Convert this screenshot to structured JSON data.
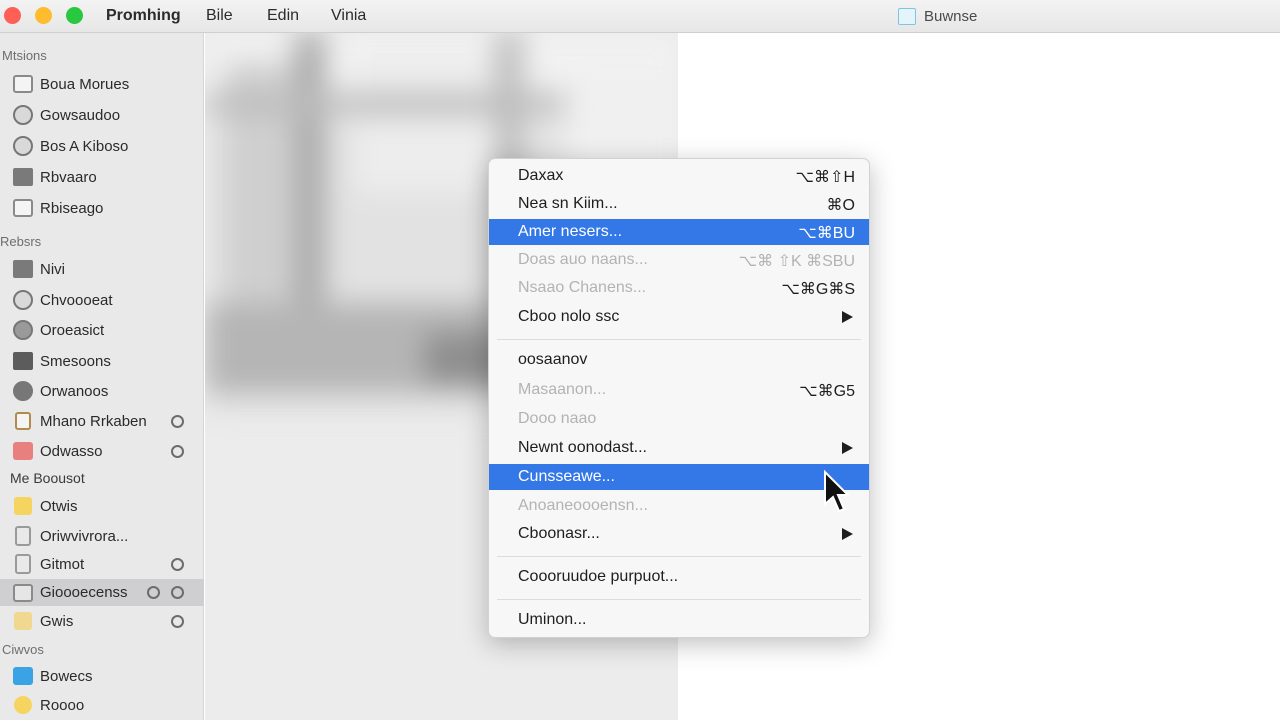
{
  "titlebar": {
    "menus": [
      "Promhing",
      "Bile",
      "Edin",
      "Vinia"
    ],
    "document_title": "Buwnse"
  },
  "sidebar": {
    "sections": [
      {
        "header": "Mtsions",
        "items": [
          {
            "label": "Boua Morues",
            "icon": "photo-icon"
          },
          {
            "label": "Gowsaudoo",
            "icon": "clock-icon"
          },
          {
            "label": "Bos A Kiboso",
            "icon": "globe-icon"
          },
          {
            "label": "Rbvaaro",
            "icon": "monitor-icon"
          },
          {
            "label": "Rbiseago",
            "icon": "image-icon"
          }
        ]
      },
      {
        "header": "Rebsrs",
        "items": [
          {
            "label": "Nivi",
            "icon": "monitor-icon"
          },
          {
            "label": "Chvoooeat",
            "icon": "gear-icon"
          },
          {
            "label": "Oroeasict",
            "icon": "gear-icon"
          },
          {
            "label": "Smesoons",
            "icon": "folder-icon"
          },
          {
            "label": "Orwanoos",
            "icon": "disc-icon"
          },
          {
            "label": "Mhano Rrkaben",
            "icon": "badge-icon",
            "badge": true
          },
          {
            "label": "Odwasso",
            "icon": "red-folder-icon",
            "badge": true
          }
        ]
      },
      {
        "header": "Me Boousot",
        "items": [
          {
            "label": "Otwis",
            "icon": "note-icon"
          },
          {
            "label": "Oriwvivrora...",
            "icon": "note-outline-icon"
          },
          {
            "label": "Gitmot",
            "icon": "note-outline-icon",
            "badge": true
          },
          {
            "label": "Gioooecenss",
            "icon": "archive-icon",
            "badge": true,
            "second_badge": true,
            "selected": true
          },
          {
            "label": "Gwis",
            "icon": "note-icon",
            "badge": true
          }
        ]
      },
      {
        "header": "Ciwvos",
        "items": [
          {
            "label": "Bowecs",
            "icon": "blue-app-icon"
          },
          {
            "label": "Roooo",
            "icon": "yellow-app-icon"
          }
        ]
      }
    ]
  },
  "context_menu": {
    "items": [
      {
        "label": "Daxax",
        "shortcut": "⌥⌘⇧H",
        "state": "normal"
      },
      {
        "label": "Nea sn Kiim...",
        "shortcut": "⌘O",
        "state": "normal"
      },
      {
        "label": "Amer nesers...",
        "shortcut": "⌥⌘BU",
        "state": "highlighted"
      },
      {
        "label": "Doas auo naans...",
        "shortcut": "⌥⌘ ⇧K ⌘SBU",
        "state": "disabled"
      },
      {
        "label": "Nsaao Chanens...",
        "shortcut": "⌥⌘G⌘S",
        "state": "disabled"
      },
      {
        "label": "Cboo nolo ssc",
        "submenu": true,
        "state": "normal"
      },
      {
        "separator": true
      },
      {
        "label": "oosaanov",
        "state": "normal"
      },
      {
        "label": "Masaanon...",
        "shortcut": "⌥⌘G5",
        "state": "disabled"
      },
      {
        "label": "Dooo naao",
        "state": "disabled"
      },
      {
        "label": "Newnt oonodast...",
        "submenu": true,
        "state": "normal"
      },
      {
        "label": "Cunsseawe...",
        "state": "highlighted"
      },
      {
        "label": "Anoaneoooensn...",
        "state": "disabled"
      },
      {
        "label": "Cboonasr...",
        "submenu": true,
        "state": "normal"
      },
      {
        "separator": true
      },
      {
        "label": "Coooruudoe purpuot...",
        "state": "normal"
      },
      {
        "separator": true
      },
      {
        "label": "Uminon...",
        "state": "normal"
      }
    ]
  },
  "colors": {
    "highlight": "#3478e8",
    "sidebar_bg": "#e9e9ea",
    "traffic_red": "#fe5f57",
    "traffic_yellow": "#febc2e",
    "traffic_green": "#28c840"
  }
}
